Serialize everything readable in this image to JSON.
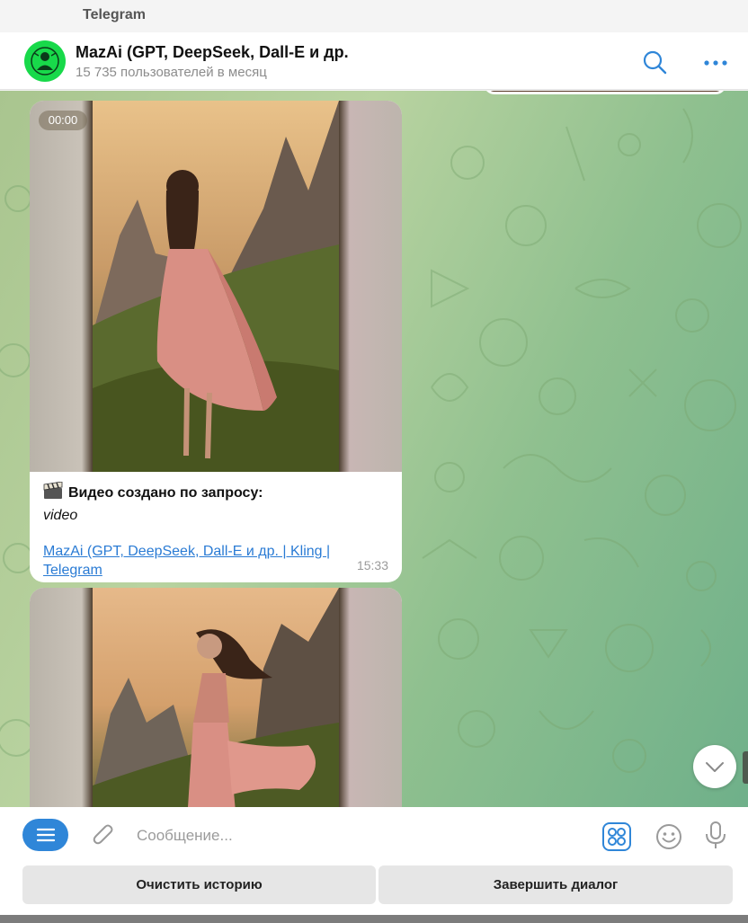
{
  "window": {
    "title": "Telegram"
  },
  "chat": {
    "name": "MazAi (GPT, DeepSeek, Dall-E и др.",
    "subtitle": "15 735 пользователей в месяц"
  },
  "icons": {
    "search": "search-icon",
    "more": "more-dots-icon",
    "menu": "menu-lines-icon",
    "attach": "paperclip-icon",
    "apps": "apps-grid-icon",
    "emoji": "smiley-icon",
    "mic": "microphone-icon",
    "scroll_down": "chevron-down-icon",
    "caption_emoji": "film-clapper-emoji"
  },
  "messages": [
    {
      "duration": "00:00",
      "caption_title": "Видео создано по запросу:",
      "caption_prompt": "video",
      "link_text": "MazAi (GPT, DeepSeek, Dall-E и др. | Kling | Telegram",
      "time": "15:33"
    }
  ],
  "input": {
    "placeholder": "Сообщение..."
  },
  "keyboard": {
    "clear_history": "Очистить историю",
    "end_dialog": "Завершить диалог"
  },
  "colors": {
    "accent": "#2f86d8",
    "link": "#2a7bd4",
    "avatar_bg": "#18d94a"
  }
}
